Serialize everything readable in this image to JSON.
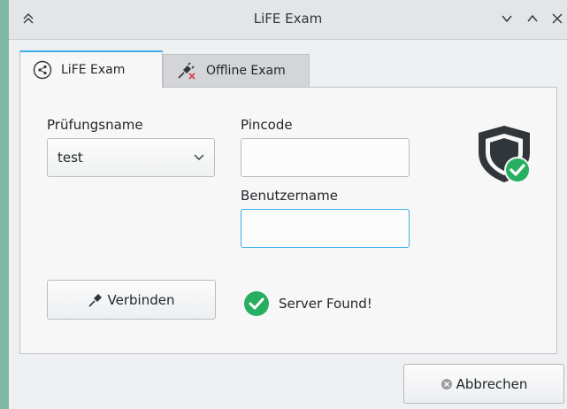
{
  "window": {
    "title": "LiFE Exam"
  },
  "tabs": [
    {
      "label": "LiFE Exam",
      "icon": "share-network-icon",
      "active": true
    },
    {
      "label": "Offline Exam",
      "icon": "disconnected-plug-icon",
      "active": false
    }
  ],
  "form": {
    "exam_name_label": "Prüfungsname",
    "exam_name_value": "test",
    "pincode_label": "Pincode",
    "pincode_value": "",
    "username_label": "Benutzername",
    "username_value": ""
  },
  "actions": {
    "connect_label": "Verbinden",
    "cancel_label": "Abbrechen"
  },
  "status": {
    "text": "Server Found!",
    "icon": "check-circle-icon"
  },
  "colors": {
    "accent": "#3daee9",
    "success": "#27ae60",
    "shield": "#31363b",
    "desktop": "#7fb8a4"
  }
}
